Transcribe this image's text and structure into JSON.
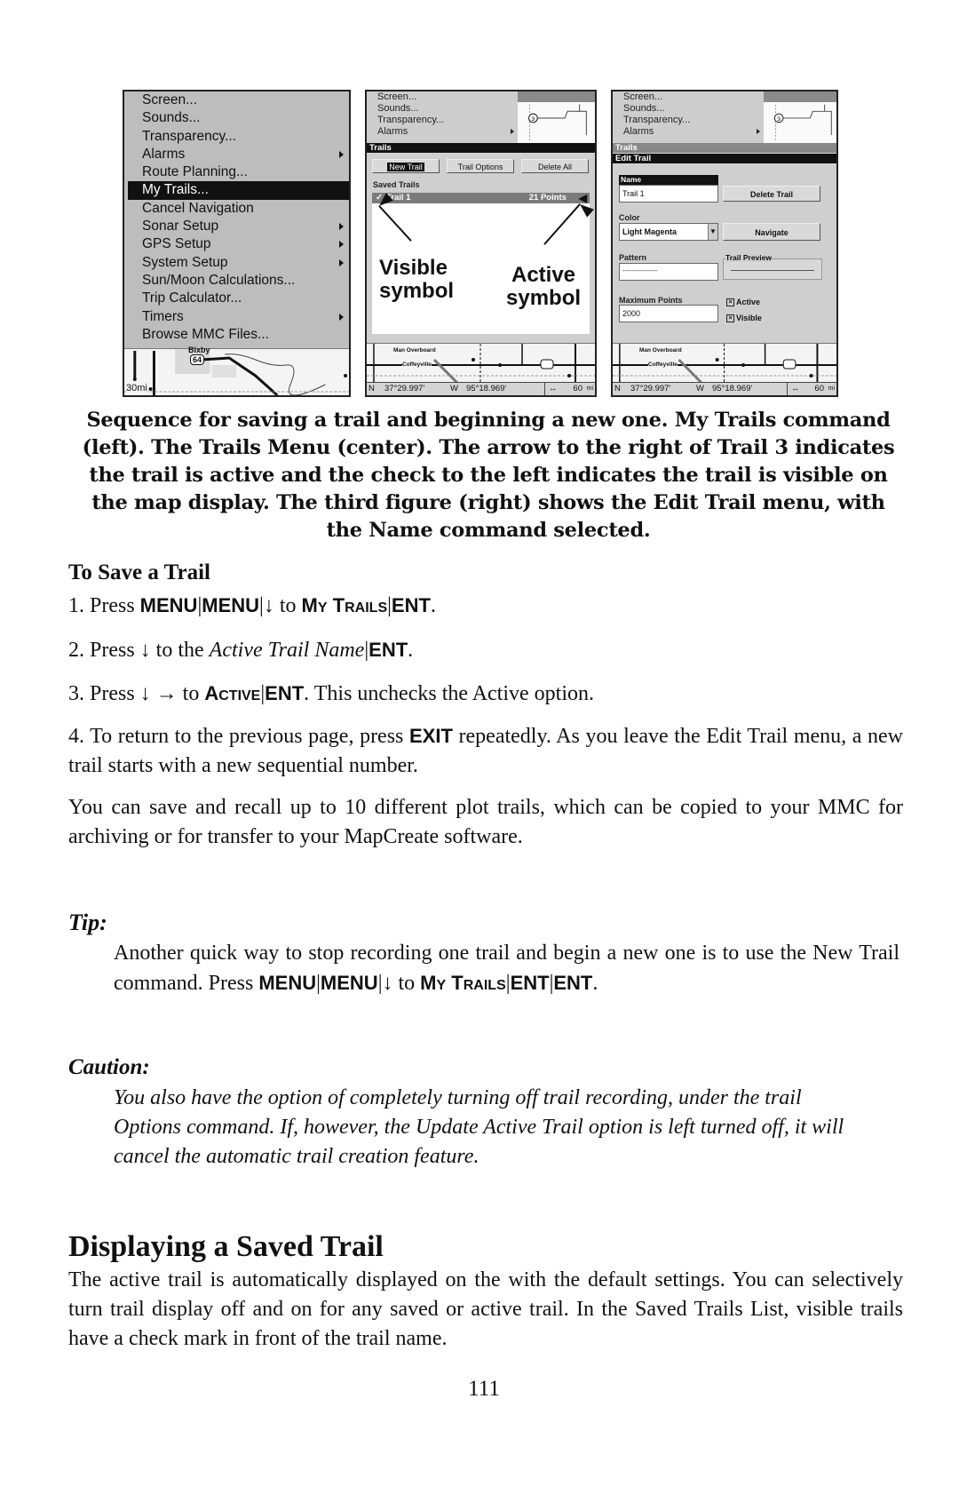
{
  "figure": {
    "left_screen": {
      "menu_items": [
        {
          "label": "Screen...",
          "submenu": false
        },
        {
          "label": "Sounds...",
          "submenu": false
        },
        {
          "label": "Transparency...",
          "submenu": false
        },
        {
          "label": "Alarms",
          "submenu": true
        },
        {
          "label": "Route Planning...",
          "submenu": false
        },
        {
          "label": "My Trails...",
          "submenu": false,
          "selected": true
        },
        {
          "label": "Cancel Navigation",
          "submenu": false
        },
        {
          "label": "Sonar Setup",
          "submenu": true
        },
        {
          "label": "GPS Setup",
          "submenu": true
        },
        {
          "label": "System Setup",
          "submenu": true
        },
        {
          "label": "Sun/Moon Calculations...",
          "submenu": false
        },
        {
          "label": "Trip Calculator...",
          "submenu": false
        },
        {
          "label": "Timers",
          "submenu": true
        },
        {
          "label": "Browse MMC Files...",
          "submenu": false
        }
      ],
      "map_label": "Bixby",
      "route_shield": "64",
      "map_scale": "30mi"
    },
    "center_screen": {
      "top_menu": [
        "Screen...",
        "Sounds...",
        "Transparency...",
        "Alarms"
      ],
      "trails_title": "Trails",
      "buttons": {
        "new_trail": "New Trail",
        "trail_options": "Trail Options",
        "delete_all": "Delete All"
      },
      "saved_trails_label": "Saved Trails",
      "trail": {
        "check": "✓",
        "name": "Trail 1",
        "points": "21 Points",
        "active_icon": "🡸"
      },
      "callouts": {
        "visible": "Visible\nsymbol",
        "visible_1": "Visible",
        "visible_2": "symbol",
        "active_1": "Active",
        "active_2": "symbol"
      },
      "map_labels": [
        "Man Overboard",
        "Coffeyville"
      ],
      "route_shields": [
        "166",
        "169"
      ]
    },
    "right_screen": {
      "top_menu": [
        "Screen...",
        "Sounds...",
        "Transparency...",
        "Alarms"
      ],
      "trails_title": "Trails",
      "edit_title": "Edit Trail",
      "name_label": "Name",
      "name_value": "Trail 1",
      "delete_trail": "Delete Trail",
      "color_label": "Color",
      "color_value": "Light Magenta",
      "navigate": "Navigate",
      "pattern_label": "Pattern",
      "pattern_value": "-----------------",
      "trail_preview_label": "Trail Preview",
      "max_points_label": "Maximum Points",
      "max_points_value": "2000",
      "active_label": "Active",
      "active_checked": true,
      "visible_label": "Visible",
      "visible_checked": true
    },
    "status": {
      "lat_hemi": "N",
      "lat": "37°29.997'",
      "lon_hemi": "W",
      "lon": "95°18.969'",
      "scale_icon": "↔",
      "scale": "60",
      "scale_unit": "mi"
    }
  },
  "caption": "Sequence for saving a trail and beginning a new one. My Trails command (left).  The Trails Menu (center). The arrow to the right of Trail 3 indicates the trail is active and the check to the left indicates the trail is visible on the map display. The third figure (right) shows the Edit Trail menu, with the Name command selected.",
  "save_trail": {
    "heading": "To Save a Trail",
    "steps": [
      {
        "num": "1. Press ",
        "k1": "MENU",
        "sep": "|",
        "k2": "MENU",
        "arrow": "↓",
        "to": " to ",
        "sc_M": "M",
        "sc_y": "Y",
        "sc_T": "T",
        "sc_rails": "RAILS",
        "k3": "ENT",
        "end": "."
      },
      {
        "num": "2. Press ",
        "arrow": "↓",
        "to": " to the ",
        "italic": "Active Trail Name",
        "sep": "|",
        "k1": "ENT",
        "end": "."
      },
      {
        "num": "3. Press ",
        "arrow": "↓ →",
        "to": " to ",
        "sc_A": "A",
        "sc_ctive": "CTIVE",
        "sep": "|",
        "k1": "ENT",
        "end": ". This unchecks the Active option."
      },
      {
        "pre": "4. To return to the previous page, press ",
        "k1": "EXIT",
        "post": " repeatedly. As you leave the Edit Trail menu, a new trail starts with a new sequential number."
      }
    ],
    "paragraph": "You can save and recall up to 10 different plot trails, which can be copied to your MMC for archiving or for transfer to your MapCreate software."
  },
  "tip": {
    "label": "Tip:",
    "text_pre": "Another quick way to stop recording one trail and begin a new one is to use the New Trail command. Press ",
    "k1": "MENU",
    "sep": "|",
    "k2": "MENU",
    "arrow": "↓",
    "to": " to ",
    "sc_M": "M",
    "sc_y": "Y",
    "sc_T": "T",
    "sc_rails": "RAILS",
    "k3": "ENT",
    "k4": "ENT",
    "end": "."
  },
  "caution": {
    "label": "Caution:",
    "text": "You also have the option of completely turning off trail recording, under the trail Options command. If, however, the Update Active Trail option is left turned off, it will cancel the automatic trail creation feature."
  },
  "displaying": {
    "heading": "Displaying a Saved Trail",
    "text": "The active trail is automatically displayed on the with the default settings. You can selectively turn trail display off and on for any saved or active trail. In the Saved Trails List, visible trails have a check mark in front of the trail name."
  },
  "page_number": "111"
}
